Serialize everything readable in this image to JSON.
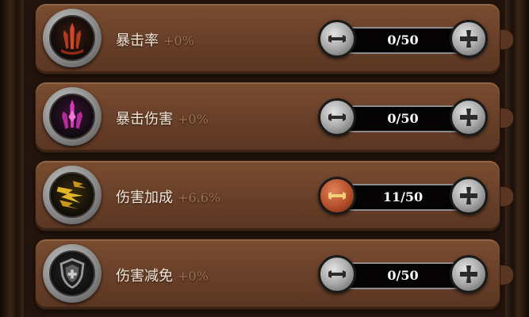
{
  "stats": [
    {
      "name": "暴击率",
      "bonus": "+0%",
      "value": "0/50",
      "icon": "crit-rate-sword-icon",
      "icon_color": "#d0482a",
      "minus_active": false
    },
    {
      "name": "暴击伤害",
      "bonus": "+0%",
      "value": "0/50",
      "icon": "crit-damage-sword-icon",
      "icon_color": "#d43bb8",
      "minus_active": false
    },
    {
      "name": "伤害加成",
      "bonus": "+6.6%",
      "value": "11/50",
      "icon": "damage-bonus-lightning-icon",
      "icon_color": "#e0b52a",
      "minus_active": true
    },
    {
      "name": "伤害减免",
      "bonus": "+0%",
      "value": "0/50",
      "icon": "damage-reduction-shield-icon",
      "icon_color": "#9a9a9a",
      "minus_active": false
    }
  ]
}
